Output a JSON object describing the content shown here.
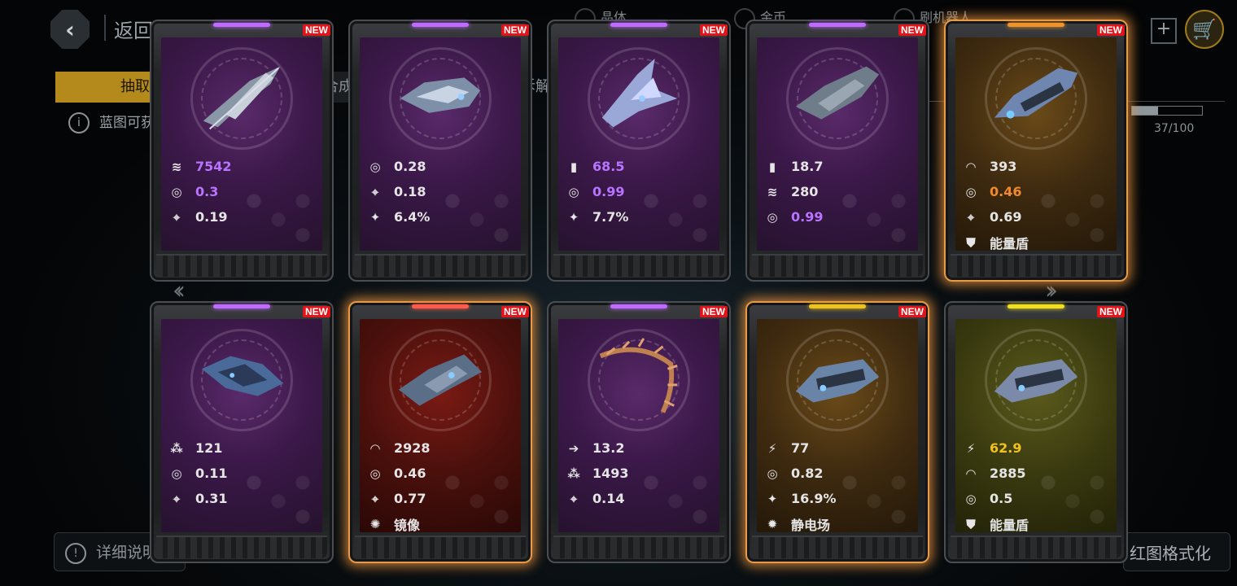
{
  "header": {
    "back_label": "返回",
    "chips": [
      "晶体",
      "金币",
      "刷机器人"
    ]
  },
  "tabs": [
    "抽取",
    "合成",
    "拆解"
  ],
  "info_text": "蓝图可获得的属性",
  "progress": {
    "text": "37/100",
    "value": 0.37
  },
  "bottom": {
    "detail_label": "详细说明",
    "right_label": "红图格式化"
  },
  "colors": {
    "purple": "#b974ff",
    "orange": "#f08a2a",
    "yellow": "#f0c21c",
    "new_badge": "#e0151b",
    "glow": "#e79a47"
  },
  "cards": [
    {
      "badge": "NEW",
      "bar": "#c06bff",
      "panel": "purple",
      "glow": false,
      "ship": "ship-a",
      "stats": [
        {
          "icon": "hull-icon",
          "glyph": "≋",
          "value": "7542",
          "tone": "purple"
        },
        {
          "icon": "cooldown-icon",
          "glyph": "◎",
          "value": "0.3",
          "tone": "purple"
        },
        {
          "icon": "crosshair-icon",
          "glyph": "⌖",
          "value": "0.19",
          "tone": "white"
        }
      ]
    },
    {
      "badge": "NEW",
      "bar": "#c06bff",
      "panel": "purple",
      "glow": false,
      "ship": "ship-b",
      "stats": [
        {
          "icon": "cooldown-icon",
          "glyph": "◎",
          "value": "0.28",
          "tone": "white"
        },
        {
          "icon": "crosshair-icon",
          "glyph": "⌖",
          "value": "0.18",
          "tone": "white"
        },
        {
          "icon": "missile-icon",
          "glyph": "✦",
          "value": "6.4%",
          "tone": "white"
        }
      ]
    },
    {
      "badge": "NEW",
      "bar": "#c06bff",
      "panel": "purple",
      "glow": false,
      "ship": "ship-c",
      "stats": [
        {
          "icon": "ammo-icon",
          "glyph": "▮",
          "value": "68.5",
          "tone": "purple"
        },
        {
          "icon": "cooldown-icon",
          "glyph": "◎",
          "value": "0.99",
          "tone": "purple"
        },
        {
          "icon": "missile-icon",
          "glyph": "✦",
          "value": "7.7%",
          "tone": "white"
        }
      ]
    },
    {
      "badge": "NEW",
      "bar": "#c06bff",
      "panel": "purple",
      "glow": false,
      "ship": "ship-d",
      "stats": [
        {
          "icon": "ammo-icon",
          "glyph": "▮",
          "value": "18.7",
          "tone": "white"
        },
        {
          "icon": "hull-icon",
          "glyph": "≋",
          "value": "280",
          "tone": "white"
        },
        {
          "icon": "cooldown-icon",
          "glyph": "◎",
          "value": "0.99",
          "tone": "purple"
        }
      ]
    },
    {
      "badge": "NEW",
      "bar": "#f0942a",
      "panel": "orange",
      "glow": true,
      "ship": "ship-e",
      "stats": [
        {
          "icon": "shield-dome-icon",
          "glyph": "◠",
          "value": "393",
          "tone": "white"
        },
        {
          "icon": "cooldown-icon",
          "glyph": "◎",
          "value": "0.46",
          "tone": "orange"
        },
        {
          "icon": "crosshair-icon",
          "glyph": "⌖",
          "value": "0.69",
          "tone": "white"
        },
        {
          "icon": "energy-shield-icon",
          "glyph": "⛊",
          "value": "能量盾",
          "tone": "white"
        }
      ]
    },
    {
      "badge": "NEW",
      "bar": "#c06bff",
      "panel": "purple",
      "glow": false,
      "ship": "ship-f",
      "stats": [
        {
          "icon": "cluster-icon",
          "glyph": "⁂",
          "value": "121",
          "tone": "white"
        },
        {
          "icon": "cooldown-icon",
          "glyph": "◎",
          "value": "0.11",
          "tone": "white"
        },
        {
          "icon": "crosshair-icon",
          "glyph": "⌖",
          "value": "0.31",
          "tone": "white"
        }
      ]
    },
    {
      "badge": "NEW",
      "bar": "#ff5a4a",
      "panel": "red",
      "glow": true,
      "ship": "ship-g",
      "stats": [
        {
          "icon": "shield-dome-icon",
          "glyph": "◠",
          "value": "2928",
          "tone": "white"
        },
        {
          "icon": "cooldown-icon",
          "glyph": "◎",
          "value": "0.46",
          "tone": "white"
        },
        {
          "icon": "crosshair-icon",
          "glyph": "⌖",
          "value": "0.77",
          "tone": "white"
        },
        {
          "icon": "mirror-icon",
          "glyph": "✺",
          "value": "镜像",
          "tone": "white"
        }
      ]
    },
    {
      "badge": "NEW",
      "bar": "#c06bff",
      "panel": "purple",
      "glow": false,
      "ship": "ship-h",
      "stats": [
        {
          "icon": "speed-arrow-icon",
          "glyph": "➔",
          "value": "13.2",
          "tone": "white"
        },
        {
          "icon": "cluster-icon",
          "glyph": "⁂",
          "value": "1493",
          "tone": "white"
        },
        {
          "icon": "crosshair-icon",
          "glyph": "⌖",
          "value": "0.14",
          "tone": "white"
        }
      ]
    },
    {
      "badge": "NEW",
      "bar": "#f0c21c",
      "panel": "orange",
      "glow": true,
      "ship": "ship-i",
      "stats": [
        {
          "icon": "damage-icon",
          "glyph": "⚡",
          "value": "77",
          "tone": "white"
        },
        {
          "icon": "cooldown-icon",
          "glyph": "◎",
          "value": "0.82",
          "tone": "white"
        },
        {
          "icon": "missile-icon",
          "glyph": "✦",
          "value": "16.9%",
          "tone": "white"
        },
        {
          "icon": "static-field-icon",
          "glyph": "✹",
          "value": "静电场",
          "tone": "white"
        }
      ]
    },
    {
      "badge": "NEW",
      "bar": "#f0e020",
      "panel": "yellow",
      "glow": false,
      "ship": "ship-j",
      "stats": [
        {
          "icon": "damage-icon",
          "glyph": "⚡",
          "value": "62.9",
          "tone": "yellow"
        },
        {
          "icon": "shield-dome-icon",
          "glyph": "◠",
          "value": "2885",
          "tone": "white"
        },
        {
          "icon": "cooldown-icon",
          "glyph": "◎",
          "value": "0.5",
          "tone": "white"
        },
        {
          "icon": "energy-shield-icon",
          "glyph": "⛊",
          "value": "能量盾",
          "tone": "white"
        }
      ]
    }
  ]
}
